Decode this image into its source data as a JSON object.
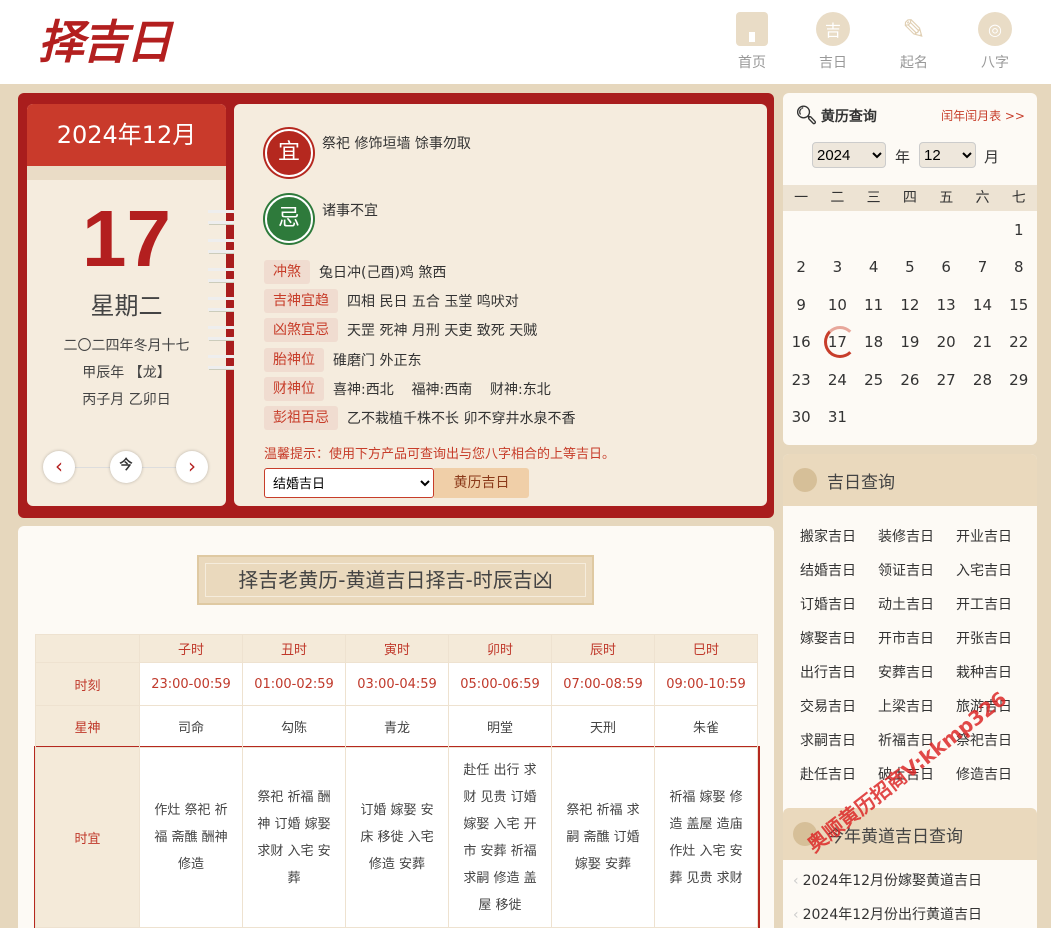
{
  "header": {
    "logo": "择吉日",
    "nav": [
      {
        "label": "首页",
        "icon": "home-icon",
        "glyph": ""
      },
      {
        "label": "吉日",
        "icon": "lucky-day-icon",
        "glyph": "吉"
      },
      {
        "label": "起名",
        "icon": "brush-icon",
        "glyph": "✎"
      },
      {
        "label": "八字",
        "icon": "scroll-icon",
        "glyph": "◎"
      }
    ]
  },
  "calendar": {
    "month_title": "2024年12月",
    "day": "17",
    "weekday": "星期二",
    "lunar_date": "二〇二四年冬月十七",
    "lunar_year": "甲辰年 【龙】",
    "ganzhi": "丙子月 乙卯日",
    "prev": "‹",
    "today": "今",
    "next": "›"
  },
  "almanac": {
    "yi_label": "宜",
    "yi_text": "祭祀 修饰垣墙 馀事勿取",
    "ji_label": "忌",
    "ji_text": "诸事不宜",
    "props": [
      {
        "tag": "冲煞",
        "value": "兔日冲(己酉)鸡 煞西"
      },
      {
        "tag": "吉神宜趋",
        "value": "四相 民日 五合 玉堂 鸣吠对"
      },
      {
        "tag": "凶煞宜忌",
        "value": "天罡 死神 月刑 天吏 致死 天贼"
      },
      {
        "tag": "胎神位",
        "value": "碓磨门 外正东"
      },
      {
        "tag": "财神位",
        "value": "喜神:西北    福神:西南    财神:东北"
      },
      {
        "tag": "彭祖百忌",
        "value": "乙不栽植千株不长 卯不穿井水泉不香"
      }
    ],
    "tip": "温馨提示：使用下方产品可查询出与您八字相合的上等吉日。",
    "select_value": "结婚吉日",
    "button": "黄历吉日"
  },
  "shichen": {
    "banner": "择吉老黄历-黄道吉日择吉-时辰吉凶",
    "columns": [
      "子时",
      "丑时",
      "寅时",
      "卯时",
      "辰时",
      "巳时"
    ],
    "row_labels": [
      "时刻",
      "星神",
      "时宜"
    ],
    "times": [
      "23:00-00:59",
      "01:00-02:59",
      "03:00-04:59",
      "05:00-06:59",
      "07:00-08:59",
      "09:00-10:59"
    ],
    "stars": [
      "司命",
      "勾陈",
      "青龙",
      "明堂",
      "天刑",
      "朱雀"
    ],
    "yi": [
      "作灶 祭祀 祈福 斋醮 酬神 修造",
      "祭祀 祈福 酬神 订婚 嫁娶 求财 入宅 安葬",
      "订婚 嫁娶 安床 移徙 入宅 修造 安葬",
      "赴任 出行 求财 见贵 订婚 嫁娶 入宅 开市 安葬 祈福 求嗣 修造 盖屋 移徙",
      "祭祀 祈福 求嗣 斋醮 订婚 嫁娶 安葬",
      "祈福 嫁娶 修造 盖屋 造庙 作灶 入宅 安葬 见贵 求财"
    ]
  },
  "huangli": {
    "title": "黄历查询",
    "more": "闰年闰月表 >>",
    "year": "2024",
    "year_label": "年",
    "month": "12",
    "month_label": "月",
    "weekdays": [
      "一",
      "二",
      "三",
      "四",
      "五",
      "六",
      "七"
    ],
    "weeks": [
      [
        "",
        "",
        "",
        "",
        "",
        "",
        "1"
      ],
      [
        "2",
        "3",
        "4",
        "5",
        "6",
        "7",
        "8"
      ],
      [
        "9",
        "10",
        "11",
        "12",
        "13",
        "14",
        "15"
      ],
      [
        "16",
        "17",
        "18",
        "19",
        "20",
        "21",
        "22"
      ],
      [
        "23",
        "24",
        "25",
        "26",
        "27",
        "28",
        "29"
      ],
      [
        "30",
        "31",
        "",
        "",
        "",
        "",
        ""
      ]
    ]
  },
  "jiri": {
    "title": "吉日查询",
    "links": [
      "搬家吉日",
      "装修吉日",
      "开业吉日",
      "结婚吉日",
      "领证吉日",
      "入宅吉日",
      "订婚吉日",
      "动土吉日",
      "开工吉日",
      "嫁娶吉日",
      "开市吉日",
      "开张吉日",
      "出行吉日",
      "安葬吉日",
      "栽种吉日",
      "交易吉日",
      "上梁吉日",
      "旅游吉日",
      "求嗣吉日",
      "祈福吉日",
      "祭祀吉日",
      "赴任吉日",
      "破土吉日",
      "修造吉日"
    ]
  },
  "year_query": {
    "title": "今年黄道吉日查询",
    "items": [
      "2024年12月份嫁娶黄道吉日",
      "2024年12月份出行黄道吉日"
    ]
  },
  "watermark": "奥顺黄历招商V:kkmp326"
}
